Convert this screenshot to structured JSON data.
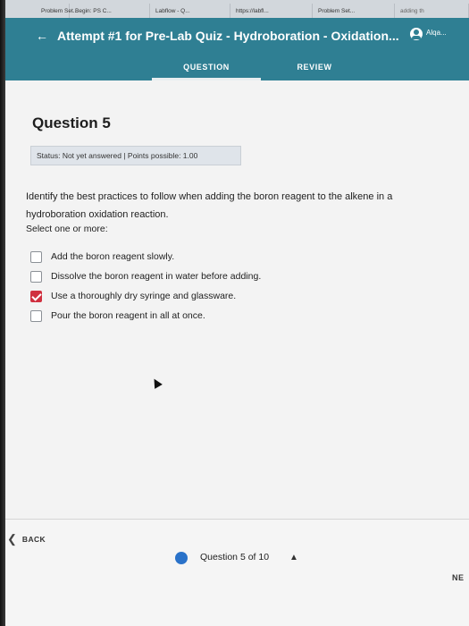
{
  "browser_tabs": [
    "Problem Set...",
    "Begin: PS C...",
    "Labflow - Q...",
    "https://labfl...",
    "Problem Set...",
    "adding th"
  ],
  "header": {
    "back_icon": "left-arrow-icon",
    "title": "Attempt #1 for Pre-Lab Quiz - Hydroboration - Oxidation...",
    "user_icon": "user-circle-icon",
    "user_name": "Alqa..."
  },
  "nav_tabs": [
    "QUESTION",
    "REVIEW"
  ],
  "question": {
    "title": "Question 5",
    "status": "Status: Not yet answered | Points possible: 1.00",
    "prompt": "Identify the best practices to follow when adding the boron reagent to the alkene in a hydroboration oxidation reaction.",
    "instruction": "Select one or more:",
    "options": [
      {
        "label": "Add the boron reagent slowly.",
        "checked": false
      },
      {
        "label": "Dissolve the boron reagent in water before adding.",
        "checked": false
      },
      {
        "label": "Use a thoroughly dry syringe and glassware.",
        "checked": true
      },
      {
        "label": "Pour the boron reagent in all at once.",
        "checked": false
      }
    ]
  },
  "footer": {
    "back_label": "BACK",
    "counter": "Question 5 of 10",
    "next_label": "NE"
  },
  "colors": {
    "header_bg": "#2f7f93",
    "checked": "#d0303f",
    "progress_dot": "#2a72c9"
  }
}
